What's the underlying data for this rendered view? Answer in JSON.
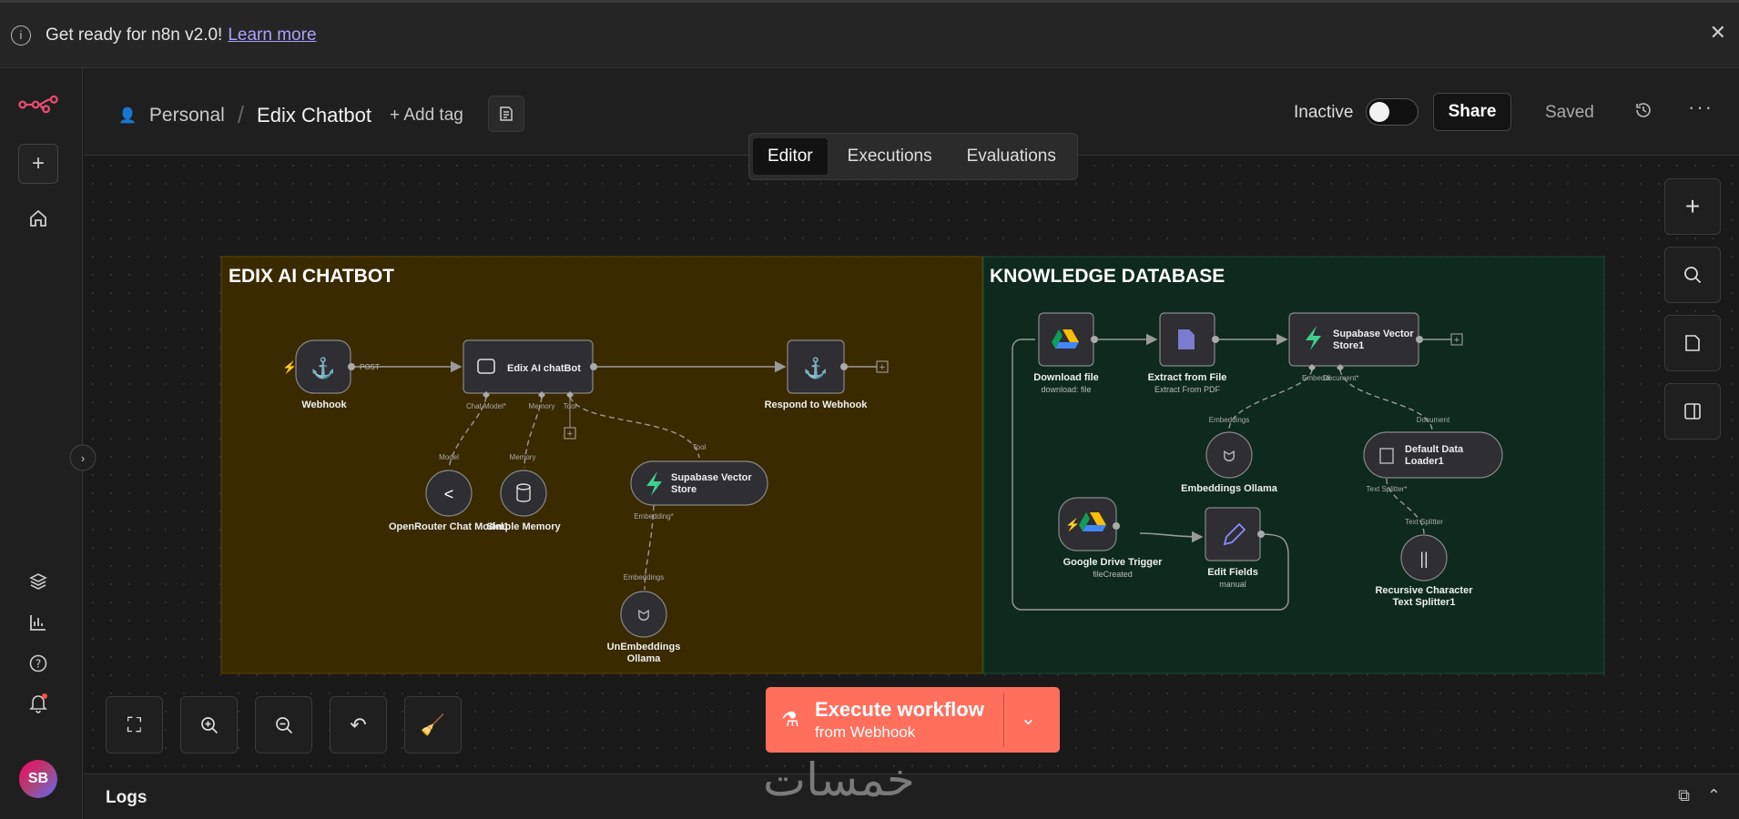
{
  "banner": {
    "text": "Get ready for n8n v2.0!",
    "link": "Learn more"
  },
  "sidebar": {
    "avatar": "SB"
  },
  "header": {
    "project": "Personal",
    "workflow_title": "Edix Chatbot",
    "add_tag": "+ Add tag",
    "status": "Inactive",
    "share": "Share",
    "saved": "Saved"
  },
  "tabs": [
    {
      "label": "Editor",
      "active": true
    },
    {
      "label": "Executions",
      "active": false
    },
    {
      "label": "Evaluations",
      "active": false
    }
  ],
  "canvas": {
    "sticky_chatbot": "EDIX AI CHATBOT",
    "sticky_knowledge": "KNOWLEDGE DATABASE",
    "nodes": {
      "webhook": "Webhook",
      "chatbot": "Edix AI chatBot",
      "respond": "Respond to Webhook",
      "openrouter": "OpenRouter Chat Model1",
      "memory": "Simple Memory",
      "supabase": "Supabase Vector Store",
      "unembeddings": "UnEmbeddings Ollama",
      "download": "Download file",
      "download_sub": "download: file",
      "extract": "Extract from File",
      "extract_sub": "Extract From PDF",
      "supabase1": "Supabase Vector Store1",
      "embeddings": "Embeddings Ollama",
      "loader": "Default Data Loader1",
      "gdrive": "Google Drive Trigger",
      "gdrive_sub": "fileCreated",
      "edit": "Edit Fields",
      "edit_sub": "manual",
      "splitter": "Recursive Character Text Splitter1"
    },
    "ports": {
      "post": "POST",
      "chat_model": "Chat Model*",
      "memory": "Memory",
      "tool": "Tool",
      "model": "Model",
      "tool_in": "Tool",
      "embedding": "Embedding*",
      "embeddings_in": "Embeddings",
      "embedd_out": "Embeddi",
      "document_out": "Document*",
      "embeddings_in2": "Embeddings",
      "document_in": "Document",
      "text_splitter_out": "Text Splitter*",
      "text_splitter_in": "Text Splitter"
    }
  },
  "execute": {
    "label": "Execute workflow",
    "sub": "from Webhook"
  },
  "logs": {
    "label": "Logs"
  },
  "watermark": "خمسات",
  "colors": {
    "accent": "#ff6f5c",
    "chatbot_sticky": "#3a2a00",
    "knowledge_sticky": "#0e2a1e"
  }
}
